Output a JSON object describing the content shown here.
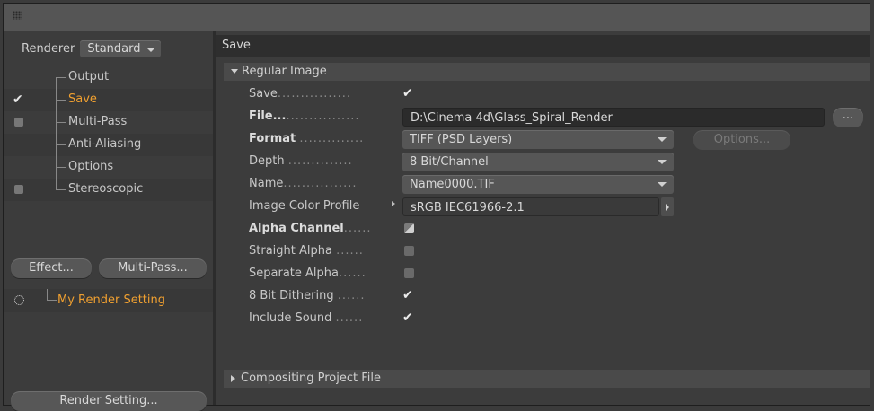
{
  "left": {
    "renderer_label": "Renderer",
    "renderer_value": "Standard",
    "tree": [
      {
        "label": "Output",
        "check": "",
        "active": false
      },
      {
        "label": "Save",
        "check": "check",
        "active": true
      },
      {
        "label": "Multi-Pass",
        "check": "box",
        "active": false
      },
      {
        "label": "Anti-Aliasing",
        "check": "",
        "active": false
      },
      {
        "label": "Options",
        "check": "",
        "active": false
      },
      {
        "label": "Stereoscopic",
        "check": "box",
        "active": false
      }
    ],
    "effect_button": "Effect...",
    "multipass_button": "Multi-Pass...",
    "render_setting_name": "My Render Setting",
    "render_setting_button": "Render Setting..."
  },
  "right": {
    "header": "Save",
    "regular_image_section": "Regular Image",
    "compositing_section": "Compositing Project File",
    "props": {
      "save": {
        "label": "Save",
        "dots": "................"
      },
      "file": {
        "label": "File...",
        "dots": "................",
        "value": "D:\\Cinema 4d\\Glass_Spiral_Render",
        "button": "..."
      },
      "format": {
        "label": "Format",
        "dots": "..............",
        "value": "TIFF (PSD Layers)",
        "options": "Options..."
      },
      "depth": {
        "label": "Depth",
        "dots": "..............",
        "value": "8 Bit/Channel"
      },
      "name": {
        "label": "Name",
        "dots": "................",
        "value": "Name0000.TIF"
      },
      "profile": {
        "label": "Image Color Profile",
        "value": "sRGB IEC61966-2.1"
      },
      "alpha": {
        "label": "Alpha Channel",
        "dots": "......"
      },
      "straight": {
        "label": "Straight Alpha",
        "dots": "......"
      },
      "separate": {
        "label": "Separate Alpha",
        "dots": "......"
      },
      "dither": {
        "label": "8 Bit Dithering",
        "dots": "......"
      },
      "sound": {
        "label": "Include Sound",
        "dots": "......"
      }
    }
  }
}
